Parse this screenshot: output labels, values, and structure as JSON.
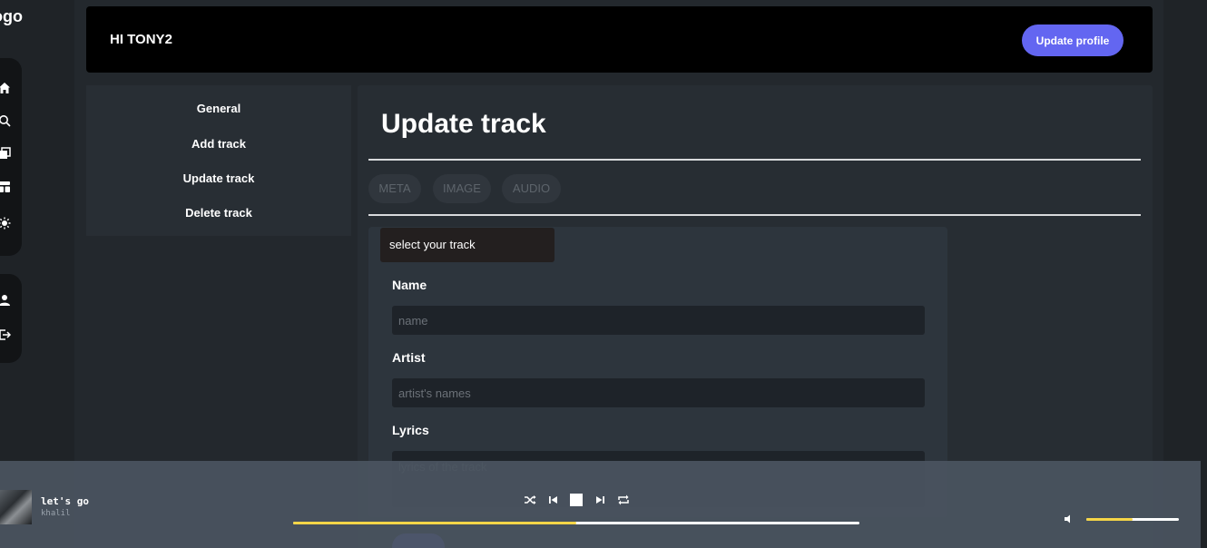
{
  "sidebar": {
    "logo": "ogo",
    "icons": [
      "home-icon",
      "search-icon",
      "library-icon",
      "layout-icon",
      "sun-icon",
      "user-icon",
      "logout-icon"
    ]
  },
  "header": {
    "greeting": "HI TONY2",
    "update_profile_label": "Update profile"
  },
  "nav": {
    "items": [
      {
        "label": "General"
      },
      {
        "label": "Add track"
      },
      {
        "label": "Update track"
      },
      {
        "label": "Delete track"
      }
    ]
  },
  "panel": {
    "title": "Update track",
    "tabs": [
      {
        "label": "META"
      },
      {
        "label": "IMAGE"
      },
      {
        "label": "AUDIO"
      }
    ]
  },
  "form": {
    "select_label": "select your track",
    "name_label": "Name",
    "name_placeholder": "name",
    "artist_label": "Artist",
    "artist_placeholder": "artist's names",
    "lyrics_label": "Lyrics",
    "lyrics_placeholder": "lyrics of the track"
  },
  "player": {
    "song_title": "let's go",
    "artist": "khalil",
    "progress_fraction": 0.5,
    "volume_fraction": 0.5
  },
  "colors": {
    "accent": "#6366f1",
    "progress": "#f5d547",
    "header_bg": "#000000"
  }
}
